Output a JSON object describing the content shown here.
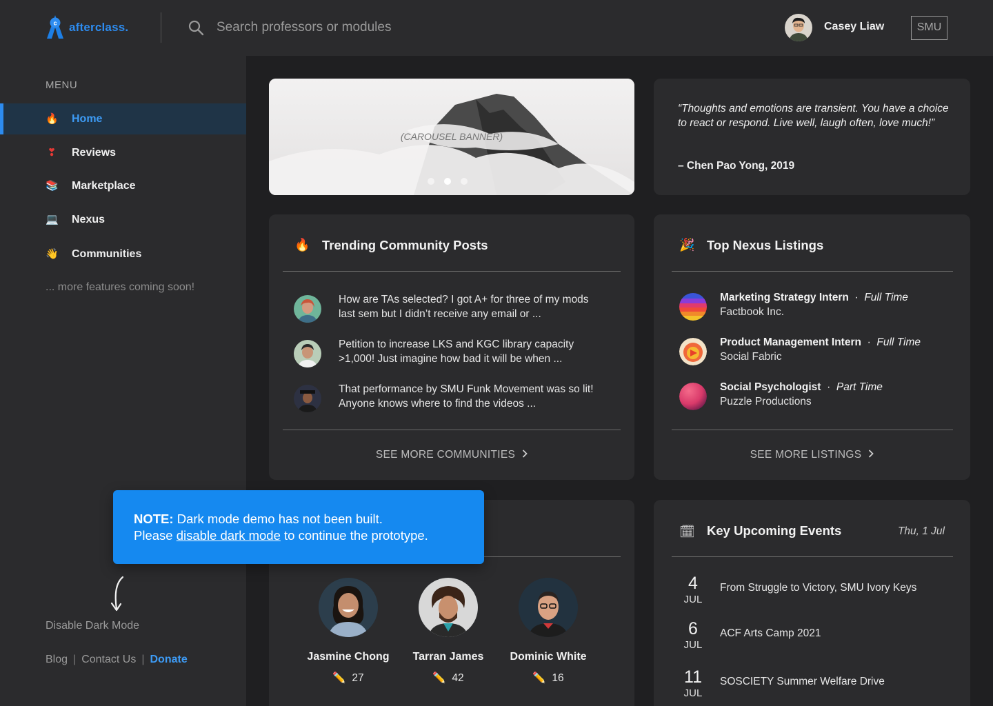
{
  "header": {
    "logo_text": "afterclass.",
    "search_placeholder": "Search professors or modules",
    "user_name": "Casey Liaw",
    "school": "SMU"
  },
  "sidebar": {
    "menu_title": "MENU",
    "items": [
      {
        "label": "Home",
        "icon": "fire-icon",
        "glyph": "🔥",
        "active": true
      },
      {
        "label": "Reviews",
        "icon": "heart-exclamation-icon",
        "glyph": "❣",
        "active": false
      },
      {
        "label": "Marketplace",
        "icon": "books-icon",
        "glyph": "📚",
        "active": false
      },
      {
        "label": "Nexus",
        "icon": "laptop-icon",
        "glyph": "💻",
        "active": false
      },
      {
        "label": "Communities",
        "icon": "waving-hand-icon",
        "glyph": "👋",
        "active": false
      }
    ],
    "coming_soon": "... more features coming soon!",
    "disable_dark_mode": "Disable Dark Mode",
    "footer": {
      "blog": "Blog",
      "contact": "Contact Us",
      "donate": "Donate",
      "separator": "|"
    }
  },
  "carousel": {
    "label": "(CAROUSEL BANNER)",
    "slide_count": 3,
    "active_slide": 2
  },
  "quote": {
    "text": "“Thoughts and emotions are transient. You have a choice to react or respond. Live well, laugh often, love much!”",
    "author": "– Chen Pao Yong, 2019"
  },
  "trending": {
    "title": "Trending Community Posts",
    "icon": "fire-icon",
    "posts": [
      {
        "text": "How are TAs selected? I got A+ for three of my mods last sem but I didn’t receive any email or ..."
      },
      {
        "text": "Petition to increase LKS and KGC library capacity >1,000! Just imagine how bad it will be when ..."
      },
      {
        "text": "That performance by SMU Funk Movement was so lit! Anyone knows where to find the videos ..."
      }
    ],
    "see_more": "SEE MORE COMMUNITIES"
  },
  "nexus": {
    "title": "Top Nexus Listings",
    "icon": "party-popper-icon",
    "listings": [
      {
        "role": "Marketing Strategy Intern",
        "type": "Full Time",
        "company": "Factbook Inc."
      },
      {
        "role": "Product Management Intern",
        "type": "Full Time",
        "company": "Social Fabric"
      },
      {
        "role": "Social Psychologist",
        "type": "Part Time",
        "company": "Puzzle Productions"
      }
    ],
    "separator": "·",
    "see_more": "SEE MORE LISTINGS"
  },
  "people": [
    {
      "name": "Jasmine Chong",
      "count": "27"
    },
    {
      "name": "Tarran James",
      "count": "42"
    },
    {
      "name": "Dominic White",
      "count": "16"
    }
  ],
  "events": {
    "title": "Key Upcoming Events",
    "icon": "calendar-icon",
    "date": "Thu, 1 Jul",
    "items": [
      {
        "day": "4",
        "month": "JUL",
        "title": "From Struggle to Victory, SMU Ivory Keys"
      },
      {
        "day": "6",
        "month": "JUL",
        "title": "ACF Arts Camp 2021"
      },
      {
        "day": "11",
        "month": "JUL",
        "title": "SOSCIETY Summer Welfare Drive"
      }
    ]
  },
  "note": {
    "prefix": "NOTE:",
    "line1": "Dark mode demo has not been built.",
    "line2_before": "Please",
    "link": "disable dark mode",
    "line2_after": "to continue the prototype."
  }
}
